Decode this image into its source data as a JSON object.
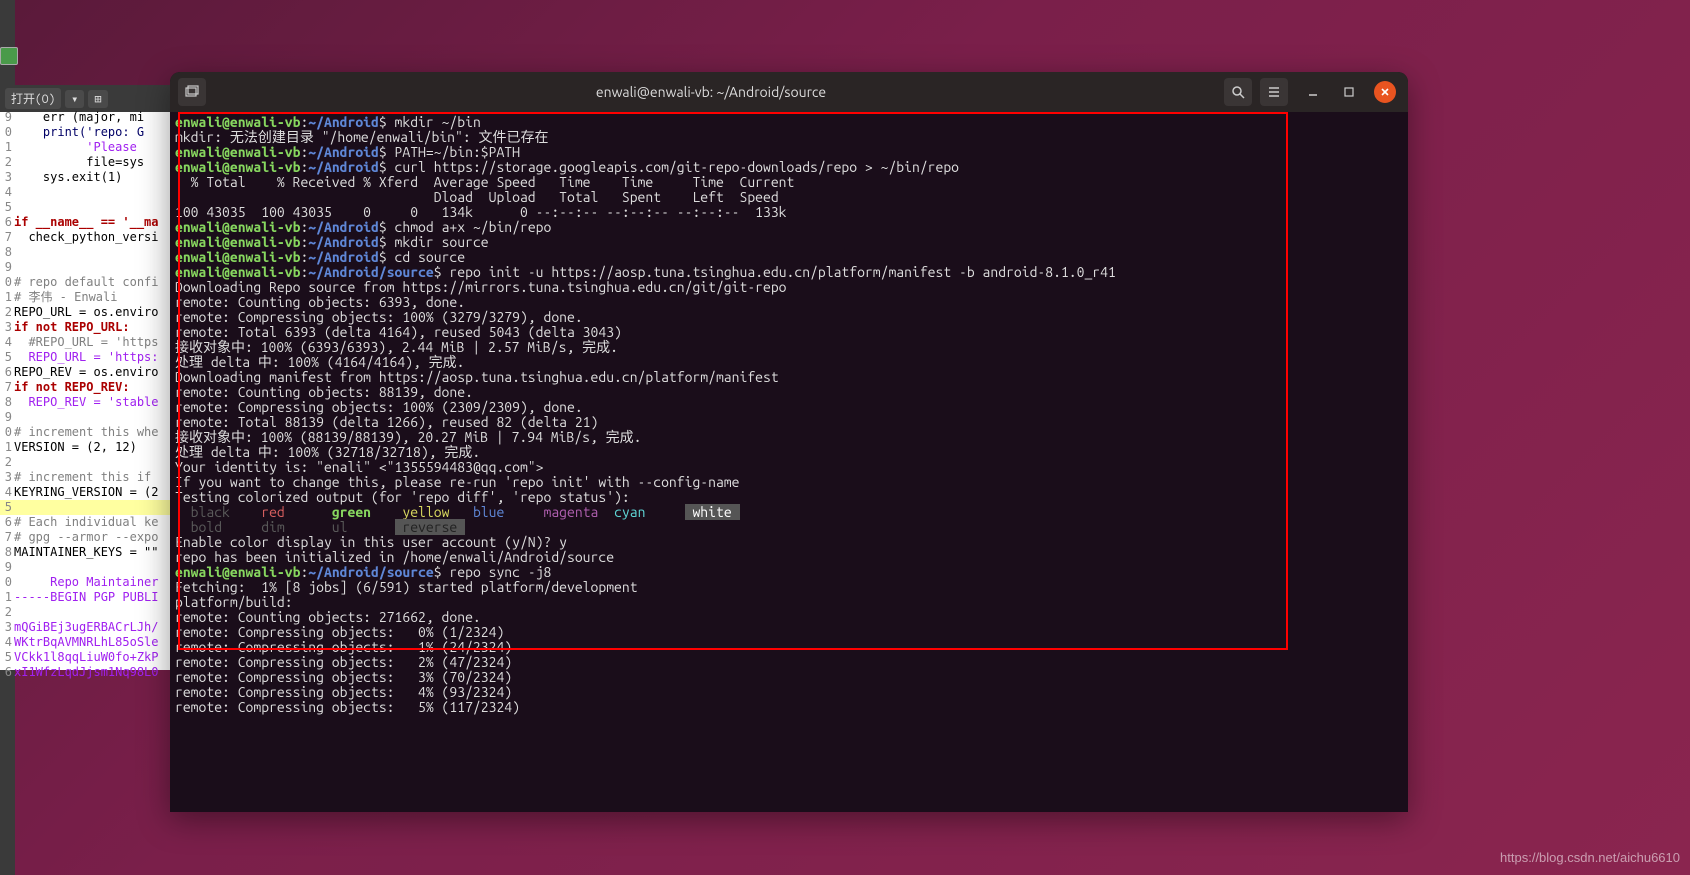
{
  "watermark": "https://blog.csdn.net/aichu6610",
  "editor_toolbar": {
    "open_label": "打开(O)",
    "dropdown": "▾",
    "new_tab": "⊞"
  },
  "editor_lines": [
    {
      "n": "9",
      "t": "    err (major, mi",
      "cls": ""
    },
    {
      "n": "0",
      "t": "    print('repo: G",
      "cls": "fn"
    },
    {
      "n": "1",
      "t": "          'Please ",
      "cls": "str"
    },
    {
      "n": "2",
      "t": "          file=sys",
      "cls": ""
    },
    {
      "n": "3",
      "t": "    sys.exit(1)",
      "cls": ""
    },
    {
      "n": "4",
      "t": "",
      "cls": ""
    },
    {
      "n": "5",
      "t": "",
      "cls": ""
    },
    {
      "n": "6",
      "t": "if __name__ == '__ma",
      "cls": "kw"
    },
    {
      "n": "7",
      "t": "  check_python_versi",
      "cls": ""
    },
    {
      "n": "8",
      "t": "",
      "cls": ""
    },
    {
      "n": "9",
      "t": "",
      "cls": ""
    },
    {
      "n": "0",
      "t": "# repo default confi",
      "cls": "cm"
    },
    {
      "n": "1",
      "t": "# 李伟 - Enwali",
      "cls": "cm"
    },
    {
      "n": "2",
      "t": "REPO_URL = os.enviro",
      "cls": ""
    },
    {
      "n": "3",
      "t": "if not REPO_URL:",
      "cls": "kw"
    },
    {
      "n": "4",
      "t": "  #REPO_URL = 'https",
      "cls": "cm"
    },
    {
      "n": "5",
      "t": "  REPO_URL = 'https:",
      "cls": "str"
    },
    {
      "n": "6",
      "t": "REPO_REV = os.enviro",
      "cls": ""
    },
    {
      "n": "7",
      "t": "if not REPO_REV:",
      "cls": "kw"
    },
    {
      "n": "8",
      "t": "  REPO_REV = 'stable",
      "cls": "str"
    },
    {
      "n": "9",
      "t": "",
      "cls": ""
    },
    {
      "n": "0",
      "t": "# increment this whe",
      "cls": "cm"
    },
    {
      "n": "1",
      "t": "VERSION = (2, 12)",
      "cls": ""
    },
    {
      "n": "2",
      "t": "",
      "cls": ""
    },
    {
      "n": "3",
      "t": "# increment this if ",
      "cls": "cm"
    },
    {
      "n": "4",
      "t": "KEYRING_VERSION = (2",
      "cls": ""
    },
    {
      "n": "5",
      "t": "",
      "cls": "",
      "hl": true
    },
    {
      "n": "6",
      "t": "# Each individual ke",
      "cls": "cm"
    },
    {
      "n": "7",
      "t": "# gpg --armor --expo",
      "cls": "cm"
    },
    {
      "n": "8",
      "t": "MAINTAINER_KEYS = \"\"",
      "cls": ""
    },
    {
      "n": "9",
      "t": "",
      "cls": ""
    },
    {
      "n": "0",
      "t": "     Repo Maintainer",
      "cls": "str"
    },
    {
      "n": "1",
      "t": "-----BEGIN PGP PUBLI",
      "cls": "str"
    },
    {
      "n": "2",
      "t": "",
      "cls": "str"
    },
    {
      "n": "3",
      "t": "mQGiBEj3ugERBACrLJh/",
      "cls": "str"
    },
    {
      "n": "4",
      "t": "WKtrBqAVMNRLhL85oSle",
      "cls": "str"
    },
    {
      "n": "5",
      "t": "VCkk1l8qqLiuW0fo+ZkP",
      "cls": "str"
    },
    {
      "n": "6",
      "t": "xI1WfzLqdJjsm1Nq98L0",
      "cls": "str"
    }
  ],
  "terminal": {
    "title": "enwali@enwali-vb: ~/Android/source",
    "lines": [
      {
        "parts": [
          {
            "c": "g",
            "t": "enwali@enwali-vb"
          },
          {
            "c": "w",
            "t": ":"
          },
          {
            "c": "b",
            "t": "~/Android"
          },
          {
            "c": "w",
            "t": "$ mkdir ~/bin"
          }
        ]
      },
      {
        "parts": [
          {
            "c": "w",
            "t": "mkdir: 无法创建目录 \"/home/enwali/bin\": 文件已存在"
          }
        ]
      },
      {
        "parts": [
          {
            "c": "g",
            "t": "enwali@enwali-vb"
          },
          {
            "c": "w",
            "t": ":"
          },
          {
            "c": "b",
            "t": "~/Android"
          },
          {
            "c": "w",
            "t": "$ PATH=~/bin:$PATH"
          }
        ]
      },
      {
        "parts": [
          {
            "c": "g",
            "t": "enwali@enwali-vb"
          },
          {
            "c": "w",
            "t": ":"
          },
          {
            "c": "b",
            "t": "~/Android"
          },
          {
            "c": "w",
            "t": "$ curl https://storage.googleapis.com/git-repo-downloads/repo > ~/bin/repo"
          }
        ]
      },
      {
        "parts": [
          {
            "c": "w",
            "t": "  % Total    % Received % Xferd  Average Speed   Time    Time     Time  Current"
          }
        ]
      },
      {
        "parts": [
          {
            "c": "w",
            "t": "                                 Dload  Upload   Total   Spent    Left  Speed"
          }
        ]
      },
      {
        "parts": [
          {
            "c": "w",
            "t": "100 43035  100 43035    0     0   134k      0 --:--:-- --:--:-- --:--:--  133k"
          }
        ]
      },
      {
        "parts": [
          {
            "c": "g",
            "t": "enwali@enwali-vb"
          },
          {
            "c": "w",
            "t": ":"
          },
          {
            "c": "b",
            "t": "~/Android"
          },
          {
            "c": "w",
            "t": "$ chmod a+x ~/bin/repo"
          }
        ]
      },
      {
        "parts": [
          {
            "c": "g",
            "t": "enwali@enwali-vb"
          },
          {
            "c": "w",
            "t": ":"
          },
          {
            "c": "b",
            "t": "~/Android"
          },
          {
            "c": "w",
            "t": "$ mkdir source"
          }
        ]
      },
      {
        "parts": [
          {
            "c": "g",
            "t": "enwali@enwali-vb"
          },
          {
            "c": "w",
            "t": ":"
          },
          {
            "c": "b",
            "t": "~/Android"
          },
          {
            "c": "w",
            "t": "$ cd source"
          }
        ]
      },
      {
        "parts": [
          {
            "c": "g",
            "t": "enwali@enwali-vb"
          },
          {
            "c": "w",
            "t": ":"
          },
          {
            "c": "b",
            "t": "~/Android/source"
          },
          {
            "c": "w",
            "t": "$ repo init -u https://aosp.tuna.tsinghua.edu.cn/platform/manifest -b android-8.1.0_r41"
          }
        ]
      },
      {
        "parts": [
          {
            "c": "w",
            "t": "Downloading Repo source from https://mirrors.tuna.tsinghua.edu.cn/git/git-repo"
          }
        ]
      },
      {
        "parts": [
          {
            "c": "w",
            "t": "remote: Counting objects: 6393, done."
          }
        ]
      },
      {
        "parts": [
          {
            "c": "w",
            "t": "remote: Compressing objects: 100% (3279/3279), done."
          }
        ]
      },
      {
        "parts": [
          {
            "c": "w",
            "t": "remote: Total 6393 (delta 4164), reused 5043 (delta 3043)"
          }
        ]
      },
      {
        "parts": [
          {
            "c": "w",
            "t": "接收对象中: 100% (6393/6393), 2.44 MiB | 2.57 MiB/s, 完成."
          }
        ]
      },
      {
        "parts": [
          {
            "c": "w",
            "t": "处理 delta 中: 100% (4164/4164), 完成."
          }
        ]
      },
      {
        "parts": [
          {
            "c": "w",
            "t": "Downloading manifest from https://aosp.tuna.tsinghua.edu.cn/platform/manifest"
          }
        ]
      },
      {
        "parts": [
          {
            "c": "w",
            "t": "remote: Counting objects: 88139, done."
          }
        ]
      },
      {
        "parts": [
          {
            "c": "w",
            "t": "remote: Compressing objects: 100% (2309/2309), done."
          }
        ]
      },
      {
        "parts": [
          {
            "c": "w",
            "t": "remote: Total 88139 (delta 1266), reused 82 (delta 21)"
          }
        ]
      },
      {
        "parts": [
          {
            "c": "w",
            "t": "接收对象中: 100% (88139/88139), 20.27 MiB | 7.94 MiB/s, 完成."
          }
        ]
      },
      {
        "parts": [
          {
            "c": "w",
            "t": "处理 delta 中: 100% (32718/32718), 完成."
          }
        ]
      },
      {
        "parts": [
          {
            "c": "w",
            "t": ""
          }
        ]
      },
      {
        "parts": [
          {
            "c": "w",
            "t": "Your identity is: \"enali\" <\"1355594483@qq.com\">"
          }
        ]
      },
      {
        "parts": [
          {
            "c": "w",
            "t": "If you want to change this, please re-run 'repo init' with --config-name"
          }
        ]
      },
      {
        "parts": [
          {
            "c": "w",
            "t": ""
          }
        ]
      },
      {
        "parts": [
          {
            "c": "w",
            "t": "Testing colorized output (for 'repo diff', 'repo status'):"
          }
        ]
      },
      {
        "parts": [
          {
            "c": "dim",
            "t": "  black    "
          },
          {
            "c": "rd",
            "t": "red      "
          },
          {
            "c": "g",
            "t": "green    "
          },
          {
            "c": "yl",
            "t": "yellow   "
          },
          {
            "c": "bl",
            "t": "blue     "
          },
          {
            "c": "mg",
            "t": "magenta  "
          },
          {
            "c": "cy",
            "t": "cyan     "
          },
          {
            "c": "wt",
            "t": " white "
          }
        ]
      },
      {
        "parts": [
          {
            "c": "dim",
            "t": "  bold    "
          },
          {
            "c": "dim",
            "t": " dim     "
          },
          {
            "c": "dim",
            "t": " ul      "
          },
          {
            "c": "rev",
            "t": " reverse "
          }
        ]
      },
      {
        "parts": [
          {
            "c": "w",
            "t": "Enable color display in this user account (y/N)? y"
          }
        ]
      },
      {
        "parts": [
          {
            "c": "w",
            "t": ""
          }
        ]
      },
      {
        "parts": [
          {
            "c": "w",
            "t": "repo has been initialized in /home/enwali/Android/source"
          }
        ]
      },
      {
        "parts": [
          {
            "c": "g",
            "t": "enwali@enwali-vb"
          },
          {
            "c": "w",
            "t": ":"
          },
          {
            "c": "b",
            "t": "~/Android/source"
          },
          {
            "c": "w",
            "t": "$ repo sync -j8"
          }
        ]
      },
      {
        "parts": [
          {
            "c": "w",
            "t": "Fetching:  1% [8 jobs] (6/591) started platform/development"
          }
        ]
      },
      {
        "parts": [
          {
            "c": "w",
            "t": "platform/build:"
          }
        ]
      },
      {
        "parts": [
          {
            "c": "w",
            "t": "remote: Counting objects: 271662, done."
          }
        ]
      },
      {
        "parts": [
          {
            "c": "w",
            "t": "remote: Compressing objects:   0% (1/2324)"
          }
        ]
      },
      {
        "parts": [
          {
            "c": "w",
            "t": "remote: Compressing objects:   1% (24/2324)"
          }
        ]
      },
      {
        "parts": [
          {
            "c": "w",
            "t": "remote: Compressing objects:   2% (47/2324)"
          }
        ]
      },
      {
        "parts": [
          {
            "c": "w",
            "t": "remote: Compressing objects:   3% (70/2324)"
          }
        ]
      },
      {
        "parts": [
          {
            "c": "w",
            "t": "remote: Compressing objects:   4% (93/2324)"
          }
        ]
      },
      {
        "parts": [
          {
            "c": "w",
            "t": "remote: Compressing objects:   5% (117/2324)"
          }
        ]
      }
    ]
  }
}
